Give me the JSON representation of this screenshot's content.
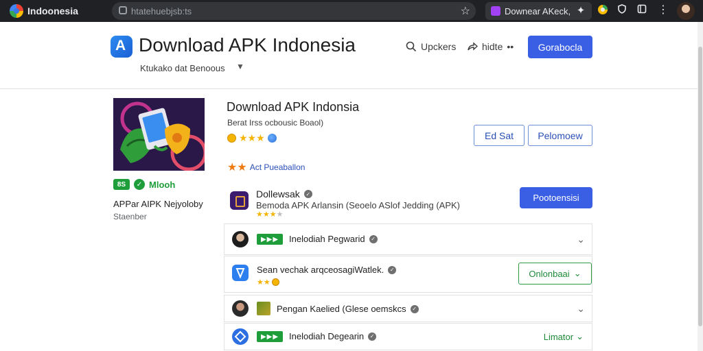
{
  "browser": {
    "tab_title": "Indoonesia",
    "url": "htatehuebjsb:ts",
    "extension_label": "Downear AKeck,"
  },
  "header": {
    "site_title": "Download APK Indonesia",
    "subtitle": "Ktukako dat Benoous",
    "links": [
      {
        "label": "Upckers",
        "icon": "search-icon"
      },
      {
        "label": "hidte",
        "icon": "share-icon"
      }
    ],
    "primary_button": "Gorabocla"
  },
  "app": {
    "title": "Download APK Indonsia",
    "meta": "Berat Irss ocbousic Boaol)",
    "rating_stars": "★★★",
    "buttons": [
      "Ed Sat",
      "Pelomoew"
    ],
    "featured_label": "Act Pueaballon",
    "featured_stars": "★★"
  },
  "sidebar": {
    "badge_text": "8S",
    "badge_label": "Mlooh",
    "name": "APPar AIPK Nejyoloby",
    "developer": "Staenber"
  },
  "main_item": {
    "title": "Dollewsak",
    "desc": "Bemoda APK Arlansin (Seoelo ASlof Jedding (APK)",
    "stars": "★★★",
    "star_off": "★",
    "button": "Pootoensisi"
  },
  "rows": [
    {
      "badge": "▶▶▶",
      "text": "Inelodiah Pegwarid",
      "action": "chevron"
    },
    {
      "text": "Sean vechak arqceosagiWatlek.",
      "stars": "★★",
      "action": "Onlonbaai"
    },
    {
      "text": "Pengan Kaelied (Glese oemskcs",
      "action": "chevron"
    },
    {
      "badge": "▶▶▶",
      "text": "Inelodiah Degearin",
      "action": "Limator"
    }
  ],
  "colors": {
    "accent": "#3a5fe5",
    "green": "#1e9e3a",
    "chrome": "#202124"
  }
}
